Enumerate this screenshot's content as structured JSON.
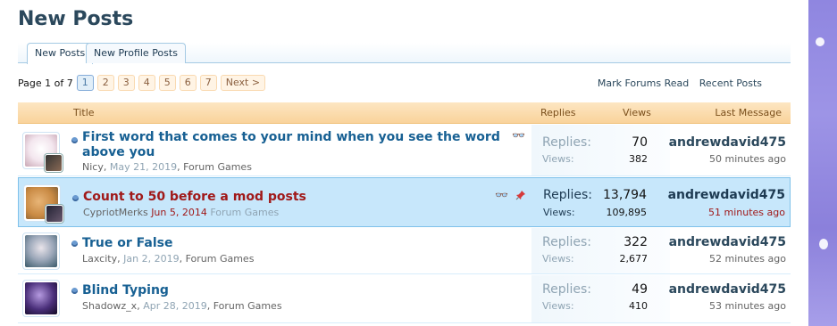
{
  "page": {
    "title": "New Posts"
  },
  "tabs": [
    {
      "label": "New Posts",
      "active": true
    },
    {
      "label": "New Profile Posts",
      "active": false
    }
  ],
  "pager": {
    "label": "Page 1 of 7",
    "pages": [
      "1",
      "2",
      "3",
      "4",
      "5",
      "6",
      "7"
    ],
    "current": "1",
    "next_label": "Next >"
  },
  "links": {
    "mark_read": "Mark Forums Read",
    "recent_posts": "Recent Posts"
  },
  "columns": {
    "title": "Title",
    "replies": "Replies",
    "views": "Views",
    "last_message": "Last Message"
  },
  "labels": {
    "replies": "Replies:",
    "views": "Views:"
  },
  "threads": [
    {
      "title": "First word that comes to your mind when you see the word above you",
      "author": "Nicy",
      "date": "May 21, 2019",
      "forum": "Forum Games",
      "replies": "70",
      "views": "382",
      "last_user": "andrewdavid475",
      "last_time": "50 minutes ago",
      "sticky": false
    },
    {
      "title": "Count to 50 before a mod posts",
      "author": "CypriotMerks",
      "date": "Jun 5, 2014",
      "forum": "Forum Games",
      "replies": "13,794",
      "views": "109,895",
      "last_user": "andrewdavid475",
      "last_time": "51 minutes ago",
      "sticky": true
    },
    {
      "title": "True or False",
      "author": "Laxcity",
      "date": "Jan 2, 2019",
      "forum": "Forum Games",
      "replies": "322",
      "views": "2,677",
      "last_user": "andrewdavid475",
      "last_time": "52 minutes ago",
      "sticky": false
    },
    {
      "title": "Blind Typing",
      "author": "Shadowz_x",
      "date": "Apr 28, 2019",
      "forum": "Forum Games",
      "replies": "49",
      "views": "410",
      "last_user": "andrewdavid475",
      "last_time": "53 minutes ago",
      "sticky": false
    }
  ],
  "colors": {
    "header_bg": "#f9d39b",
    "sticky_bg": "#c7e7fb",
    "link": "#176093",
    "sticky_title": "#a01919"
  }
}
